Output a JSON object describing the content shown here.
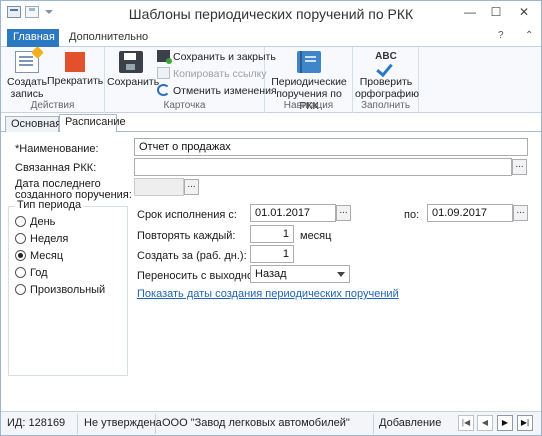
{
  "window": {
    "title": "Шаблоны периодических поручений по РКК"
  },
  "title_controls": {
    "minimize": "—",
    "maximize": "☐",
    "close": "✕",
    "help": "?",
    "collapse": "⌃"
  },
  "ribbon_tabs": [
    {
      "label": "Главная",
      "active": true
    },
    {
      "label": "Дополнительно",
      "active": false
    }
  ],
  "ribbon": {
    "groups": {
      "actions": "Действия",
      "card": "Карточка",
      "navigation": "Навигация",
      "fill": "Заполнить"
    },
    "buttons": {
      "create": "Создать запись",
      "stop": "Прекратить",
      "save": "Сохранить",
      "save_close": "Сохранить и закрыть",
      "copy_link": "Копировать ссылку",
      "undo": "Отменить изменения",
      "periodic": "Периодические поручения по РКК",
      "spell": "Проверить орфографию",
      "spell_icon_text": "ABC"
    }
  },
  "content_tabs": [
    {
      "label": "Основная",
      "active": false
    },
    {
      "label": "Расписание",
      "active": true
    }
  ],
  "form": {
    "name_label": "*Наименование:",
    "name_value": "Отчет о продажах",
    "rkk_label": "Связанная РКК:",
    "rkk_value": "",
    "last_date_label_1": "Дата последнего",
    "last_date_label_2": "созданного поручения:",
    "last_date_value": "",
    "dots": "...",
    "period_type_title": "Тип периода",
    "period_options": [
      {
        "label": "День",
        "checked": false
      },
      {
        "label": "Неделя",
        "checked": false
      },
      {
        "label": "Месяц",
        "checked": true
      },
      {
        "label": "Год",
        "checked": false
      },
      {
        "label": "Произвольный",
        "checked": false
      }
    ],
    "deadline_label": "Срок исполнения с:",
    "deadline_from": "01.01.2017",
    "to_label": "по:",
    "deadline_to": "01.09.2017",
    "repeat_label": "Повторять каждый:",
    "repeat_value": "1",
    "repeat_unit": "месяц",
    "create_before_label": "Создать за (раб. дн.):",
    "create_before_value": "1",
    "weekend_label": "Переносить с выходного:",
    "weekend_value": "Назад",
    "show_dates_link": "Показать даты создания периодических поручений"
  },
  "statusbar": {
    "id": "ИД: 128169",
    "state": "Не утверждена",
    "org": "ООО \"Завод легковых автомобилей\"",
    "mode": "Добавление",
    "nav_first": "|◀",
    "nav_prev": "◀",
    "nav_next": "▶",
    "nav_last": "▶|"
  }
}
